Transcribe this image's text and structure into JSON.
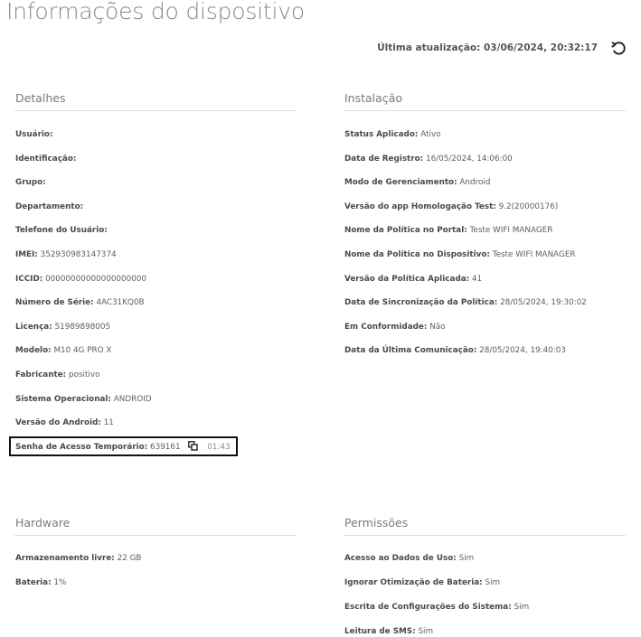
{
  "header": {
    "title": "Informações do dispositivo",
    "last_update_label": "Última atualização:",
    "last_update_value": "03/06/2024, 20:32:17"
  },
  "details": {
    "title": "Detalhes",
    "rows": [
      {
        "label": "Usuário:",
        "value": ""
      },
      {
        "label": "Identificação:",
        "value": ""
      },
      {
        "label": "Grupo:",
        "value": ""
      },
      {
        "label": "Departamento:",
        "value": ""
      },
      {
        "label": "Telefone do Usuário:",
        "value": ""
      },
      {
        "label": "IMEI:",
        "value": "352930983147374"
      },
      {
        "label": "ICCID:",
        "value": "00000000000000000000"
      },
      {
        "label": "Número de Série:",
        "value": "4AC31KQ0B"
      },
      {
        "label": "Licença:",
        "value": "51989898005"
      },
      {
        "label": "Modelo:",
        "value": "M10 4G PRO X"
      },
      {
        "label": "Fabricante:",
        "value": "positivo"
      },
      {
        "label": "Sistema Operacional:",
        "value": "ANDROID"
      },
      {
        "label": "Versão do Android:",
        "value": "11"
      }
    ],
    "temp_password": {
      "label": "Senha de Acesso Temporário:",
      "value": "639161",
      "timer": "01:43"
    }
  },
  "installation": {
    "title": "Instalação",
    "rows": [
      {
        "label": "Status Aplicado:",
        "value": "Ativo"
      },
      {
        "label": "Data de Registro:",
        "value": "16/05/2024, 14:06:00"
      },
      {
        "label": "Modo de Gerenciamento:",
        "value": "Android"
      },
      {
        "label": "Versão do app Homologação Test:",
        "value": "9.2(20000176)"
      },
      {
        "label": "Nome da Política no Portal:",
        "value": "Teste WIFI MANAGER"
      },
      {
        "label": "Nome da Política no Dispositivo:",
        "value": "Teste WIFI MANAGER"
      },
      {
        "label": "Versão da Política Aplicada:",
        "value": "41"
      },
      {
        "label": "Data de Sincronização da Política:",
        "value": "28/05/2024, 19:30:02"
      },
      {
        "label": "Em Conformidade:",
        "value": "Não"
      },
      {
        "label": "Data da Última Comunicação:",
        "value": "28/05/2024, 19:40:03"
      }
    ]
  },
  "hardware": {
    "title": "Hardware",
    "rows": [
      {
        "label": "Armazenamento livre:",
        "value": "22 GB"
      },
      {
        "label": "Bateria:",
        "value": "1%"
      }
    ]
  },
  "permissions": {
    "title": "Permissões",
    "rows": [
      {
        "label": "Acesso ao Dados de Uso:",
        "value": "Sim"
      },
      {
        "label": "Ignorar Otimização de Bateria:",
        "value": "Sim"
      },
      {
        "label": "Escrita de Configurações do Sistema:",
        "value": "Sim"
      },
      {
        "label": "Leitura de SMS:",
        "value": "Sim"
      }
    ]
  },
  "icons": {
    "refresh": "refresh-icon",
    "copy": "copy-icon"
  }
}
